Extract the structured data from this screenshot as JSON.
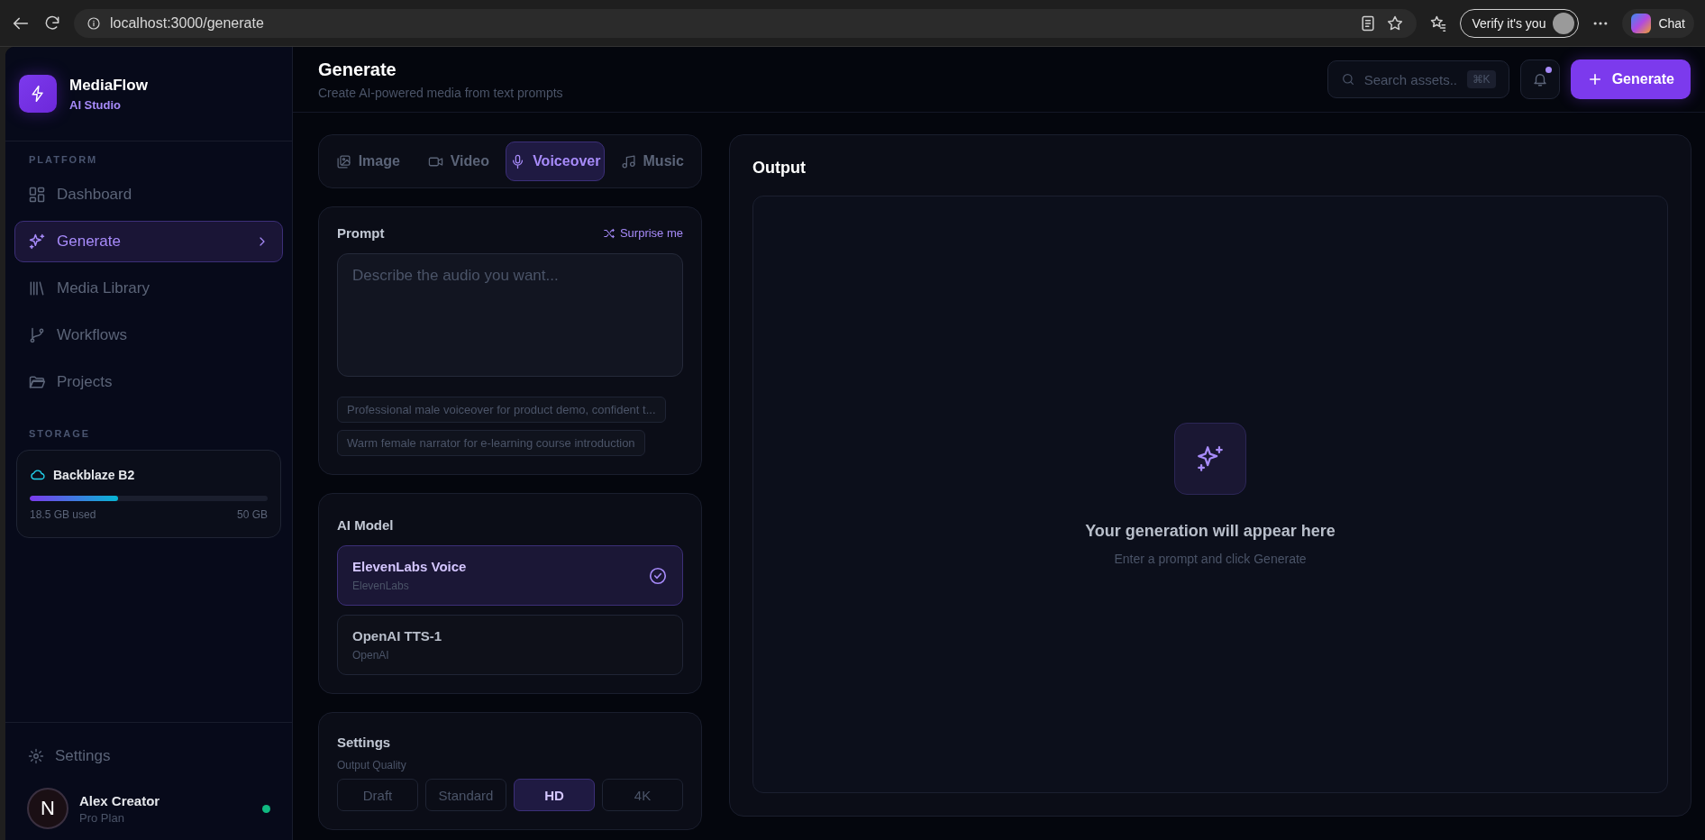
{
  "browser": {
    "url": "localhost:3000/generate",
    "profile_button": "Verify it's you",
    "chat_button": "Chat"
  },
  "brand": {
    "name": "MediaFlow",
    "subtitle": "AI Studio"
  },
  "sidebar": {
    "section_label": "PLATFORM",
    "items": [
      {
        "label": "Dashboard",
        "selected": false
      },
      {
        "label": "Generate",
        "selected": true
      },
      {
        "label": "Media Library",
        "selected": false
      },
      {
        "label": "Workflows",
        "selected": false
      },
      {
        "label": "Projects",
        "selected": false
      }
    ],
    "storage_label": "STORAGE",
    "storage": {
      "name": "Backblaze B2",
      "level": 0.37,
      "used": "18.5 GB used",
      "total": "50 GB"
    },
    "settings": "Settings",
    "user": {
      "initial": "N",
      "name": "Alex Creator",
      "plan": "Pro Plan",
      "online": true
    }
  },
  "header": {
    "title": "Generate",
    "subtitle": "Create AI-powered media from text prompts",
    "search": {
      "placeholder": "Search assets...",
      "shortcut": "⌘K"
    },
    "notifications_unread": true,
    "generate_button": "Generate"
  },
  "tabs": [
    {
      "label": "Image",
      "selected": false
    },
    {
      "label": "Video",
      "selected": false
    },
    {
      "label": "Voiceover",
      "selected": true
    },
    {
      "label": "Music",
      "selected": false
    }
  ],
  "prompt": {
    "title": "Prompt",
    "surprise": "Surprise me",
    "placeholder": "Describe the audio you want...",
    "suggestions": [
      "Professional male voiceover for product demo, confident t...",
      "Warm female narrator for e-learning course introduction"
    ]
  },
  "model": {
    "title": "AI Model",
    "options": [
      {
        "name": "ElevenLabs Voice",
        "provider": "ElevenLabs",
        "selected": true
      },
      {
        "name": "OpenAI TTS-1",
        "provider": "OpenAI",
        "selected": false
      }
    ]
  },
  "settings": {
    "title": "Settings",
    "quality_label": "Output Quality",
    "qualities": [
      {
        "label": "Draft",
        "selected": false
      },
      {
        "label": "Standard",
        "selected": false
      },
      {
        "label": "HD",
        "selected": true
      },
      {
        "label": "4K",
        "selected": false
      }
    ]
  },
  "output": {
    "title": "Output",
    "empty_title": "Your generation will appear here",
    "empty_hint": "Enter a prompt and click Generate"
  }
}
